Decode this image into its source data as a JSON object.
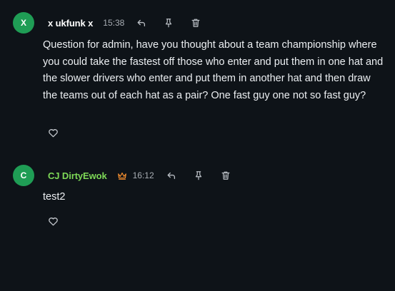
{
  "messages": [
    {
      "avatar_initial": "X",
      "avatar_color": "#1f9d55",
      "author": "x ukfunk x",
      "author_color": "#ffffff",
      "time": "15:38",
      "has_crown": false,
      "text": "Question for admin, have you thought about a team championship where you could take the fastest off those who enter and put them in one hat and the slower drivers who enter and put them in another hat and then draw the teams out of each hat as a pair? One fast guy one not so fast guy?",
      "actions": [
        "reply-icon",
        "pin-icon",
        "trash-icon"
      ],
      "like_icon": "heart-icon"
    },
    {
      "avatar_initial": "C",
      "avatar_color": "#1f9d55",
      "author": "CJ DirtyEwok",
      "author_color": "#7ed957",
      "time": "16:12",
      "has_crown": true,
      "crown_color": "#f08c2e",
      "text": "test2",
      "actions": [
        "reply-icon",
        "pin-icon",
        "trash-icon"
      ],
      "like_icon": "heart-icon"
    }
  ]
}
